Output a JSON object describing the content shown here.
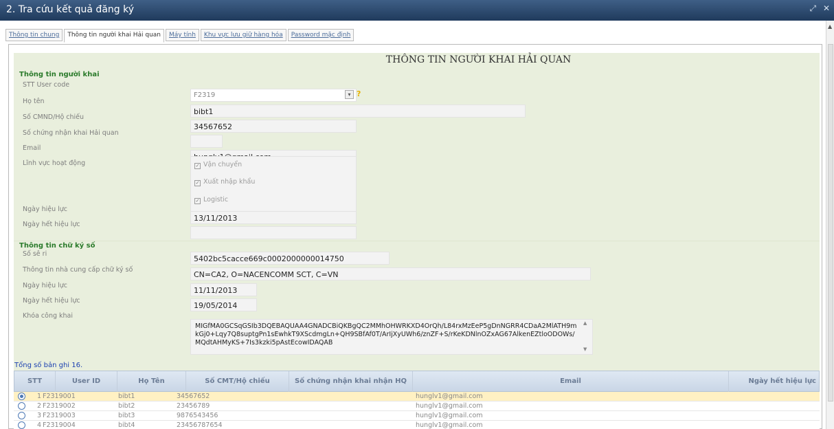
{
  "window": {
    "title": "2. Tra cứu kết quả đăng ký",
    "controls": [
      "restore-icon",
      "close-icon"
    ]
  },
  "tabs": [
    {
      "label": "Thông tin chung",
      "active": false
    },
    {
      "label": "Thông tin người khai Hải quan",
      "active": true
    },
    {
      "label": "Máy tính",
      "active": false
    },
    {
      "label": "Khu vực lưu giữ hàng hóa",
      "active": false
    },
    {
      "label": "Password mặc định",
      "active": false
    }
  ],
  "form": {
    "title": "THÔNG TIN NGƯỜI KHAI HẢI QUAN",
    "declarant_section": "Thông tin người khai",
    "fields": {
      "user_code": {
        "label": "STT User code",
        "value": "F2319"
      },
      "full_name": {
        "label": "Họ tên",
        "value": "bibt1"
      },
      "id_number": {
        "label": "Số CMND/Hộ chiếu",
        "value": "34567652"
      },
      "customs_cert": {
        "label": "Số chứng nhận khai Hải quan",
        "value": ""
      },
      "email": {
        "label": "Email",
        "value": "hunglv1@gmail.com"
      },
      "activity": {
        "label": "Lĩnh vực hoạt động",
        "options": [
          "Vận chuyển",
          "Xuất nhập khẩu",
          "Logistic"
        ]
      },
      "effective_date": {
        "label": "Ngày hiệu lực",
        "value": "13/11/2013"
      },
      "expiry_date": {
        "label": "Ngày hết hiệu lực",
        "value": ""
      }
    },
    "signature_section": "Thông tin chữ ký số",
    "signature": {
      "serial": {
        "label": "Số sê ri",
        "value": "5402bc5cacce669c0002000000014750"
      },
      "provider": {
        "label": "Thông tin nhà cung cấp chữ ký số",
        "value": "CN=CA2, O=NACENCOMM SCT, C=VN"
      },
      "effective_date": {
        "label": "Ngày hiệu lực",
        "value": "11/11/2013"
      },
      "expiry_date": {
        "label": "Ngày hết hiệu lực",
        "value": "19/05/2014"
      },
      "public_key": {
        "label": "Khóa công khai",
        "value": "MIGfMA0GCSqGSIb3DQEBAQUAA4GNADCBiQKBgQC2MMhOHWRKXD4OrQh/L84rxMzEeP5gDnNGRR4CDaA2MlATH9mkGj0+Lqy7Q8suptgPn1sEwhkT9XScdmgLn+QH9SBfAf0T/ArIjXyUWh6/znZF+S/rKeKDNlnOZxAG67AlkenEZtloODOWs/MQdtAHMyKS+7Is3kzki5pAstEcowIDAQAB"
      }
    }
  },
  "grid": {
    "total_text": "Tổng số bản ghi 16.",
    "columns": [
      "STT",
      "User ID",
      "Họ Tên",
      "Số CMT/Hộ chiếu",
      "Số chứng nhận khai nhận HQ",
      "Email",
      "Ngày hết hiệu lực"
    ],
    "rows": [
      {
        "stt": "1",
        "user_id": "F2319001",
        "name": "bibt1",
        "id_no": "34567652",
        "cert": "",
        "email": "hunglv1@gmail.com",
        "expiry": "",
        "selected": true
      },
      {
        "stt": "2",
        "user_id": "F2319002",
        "name": "bibt2",
        "id_no": "23456789",
        "cert": "",
        "email": "hunglv1@gmail.com",
        "expiry": "",
        "selected": false
      },
      {
        "stt": "3",
        "user_id": "F2319003",
        "name": "bibt3",
        "id_no": "9876543456",
        "cert": "",
        "email": "hunglv1@gmail.com",
        "expiry": "",
        "selected": false
      },
      {
        "stt": "4",
        "user_id": "F2319004",
        "name": "bibt4",
        "id_no": "23456787654",
        "cert": "",
        "email": "hunglv1@gmail.com",
        "expiry": "",
        "selected": false
      }
    ]
  }
}
